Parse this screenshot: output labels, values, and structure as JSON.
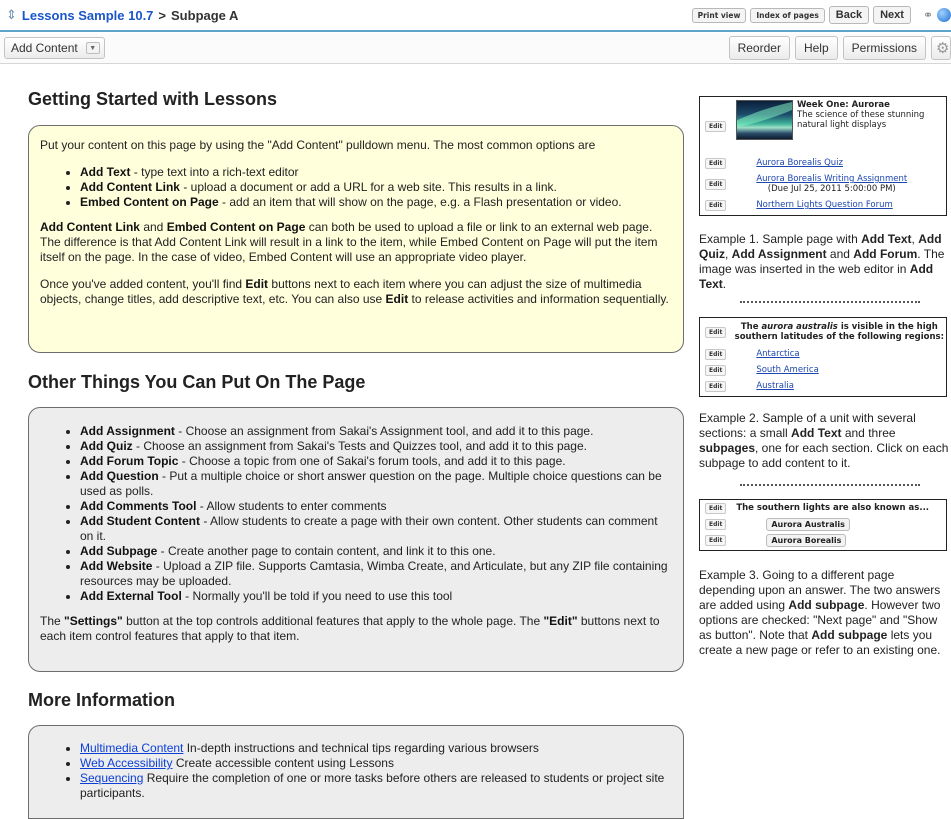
{
  "topbar": {
    "site": "Lessons Sample 10.7",
    "separator": ">",
    "page": "Subpage A",
    "print_view": "Print view",
    "index_of_pages": "Index of pages",
    "back": "Back",
    "next": "Next",
    "link_icon": "link-icon",
    "help_icon": "help-icon"
  },
  "toolbar": {
    "add_content": "Add Content",
    "reorder": "Reorder",
    "help": "Help",
    "permissions": "Permissions",
    "settings_icon": "gear-icon"
  },
  "sections": {
    "getting_started": {
      "title": "Getting Started with Lessons",
      "intro": "Put your content on this page by using the \"Add Content\" pulldown menu. The most common options are",
      "items": [
        {
          "label": "Add Text",
          "text": " - type text into a rich-text editor"
        },
        {
          "label": "Add Content Link",
          "text": " - upload a document or add a URL for a web site. This results in a link."
        },
        {
          "label": "Embed Content on Page",
          "text": " - add an item that will show on the page, e.g. a Flash presentation or video."
        }
      ],
      "p2_a": "Add Content Link",
      "p2_b": " and ",
      "p2_c": "Embed Content on Page",
      "p2_d": " can both be used to upload a file or link to an external web page. The difference is that Add Content Link will result in a link to the item, while Embed Content on Page will put the item itself on the page. In the case of video, Embed Content will use an appropriate video player.",
      "p3_a": "Once you've added content, you'll find ",
      "p3_b": "Edit",
      "p3_c": " buttons next to each item where you can adjust the size of multimedia objects, change titles, add descriptive text, etc. You can also use ",
      "p3_d": "Edit",
      "p3_e": " to release activities and information sequentially."
    },
    "other_things": {
      "title": "Other Things You Can Put On The Page",
      "items": [
        {
          "label": "Add Assignment",
          "text": " - Choose an assignment from Sakai's Assignment tool, and add it to this page."
        },
        {
          "label": "Add Quiz",
          "text": " - Choose an assignment from Sakai's Tests and Quizzes tool, and add it to this page."
        },
        {
          "label": "Add Forum Topic",
          "text": " - Choose a topic from one of Sakai's forum tools, and add it to this page."
        },
        {
          "label": "Add Question",
          "text": " - Put a multiple choice or short answer question on the page. Multiple choice questions can be used as polls."
        },
        {
          "label": "Add Comments Tool",
          "text": " - Allow students to enter comments"
        },
        {
          "label": "Add Student Content",
          "text": " - Allow students to create a page with their own content. Other students can comment on it."
        },
        {
          "label": "Add Subpage",
          "text": " - Create another page to contain content, and link it to this one."
        },
        {
          "label": "Add Website",
          "text": " - Upload a ZIP file. Supports Camtasia, Wimba Create, and Articulate, but any ZIP file containing resources may be uploaded."
        },
        {
          "label": "Add External Tool",
          "text": " - Normally you'll be told if you need to use this tool"
        }
      ],
      "p_a": "The ",
      "p_b": "\"Settings\"",
      "p_c": " button at the top controls additional features that apply to the whole page. The ",
      "p_d": "\"Edit\"",
      "p_e": " buttons next to each item control features that apply to that item."
    },
    "more_info": {
      "title": "More Information",
      "items": [
        {
          "link": "Multimedia Content",
          "text": " In-depth instructions and technical tips regarding various browsers"
        },
        {
          "link": "Web Accessibility",
          "text": " Create accessible content using Lessons"
        },
        {
          "link": "Sequencing",
          "text": " Require the completion of one or more tasks before others are released to students or project site participants."
        }
      ]
    }
  },
  "examples": {
    "ex1": {
      "edit": "Edit",
      "heading": "Week One: Aurorae",
      "desc": "The science of these stunning natural light displays",
      "quiz": "Aurora Borealis Quiz",
      "assignment": "Aurora Borealis Writing Assignment",
      "due": "(Due Jul 25, 2011 5:00:00 PM)",
      "forum": "Northern Lights Question Forum",
      "caption_a": "Example 1. Sample page with ",
      "caption_b": "Add Text",
      "caption_c": ", ",
      "caption_d": "Add Quiz",
      "caption_e": ", ",
      "caption_f": "Add Assignment",
      "caption_g": " and ",
      "caption_h": "Add Forum",
      "caption_i": ". The image was inserted in the web editor in ",
      "caption_j": "Add Text",
      "caption_k": "."
    },
    "ex2": {
      "edit": "Edit",
      "text_a": "The ",
      "text_b": "aurora australis",
      "text_c": " is visible in the high southern latitudes of the following regions:",
      "links": [
        "Antarctica",
        "South America",
        "Australia"
      ],
      "caption_a": "Example 2. Sample of a unit with several sections: a small ",
      "caption_b": "Add Text",
      "caption_c": " and three ",
      "caption_d": "subpages",
      "caption_e": ", one for each section. Click on each subpage to add content to it."
    },
    "ex3": {
      "edit": "Edit",
      "text": "The southern lights are also known as...",
      "answers": [
        "Aurora Australis",
        "Aurora Borealis"
      ],
      "caption_a": "Example 3. Going to a different page depending upon an answer. The two answers are added using ",
      "caption_b": "Add subpage",
      "caption_c": ". However two options are checked: \"Next page\" and \"Show as button\". Note that ",
      "caption_d": "Add subpage",
      "caption_e": " lets you create a new page or refer to an existing one."
    }
  }
}
